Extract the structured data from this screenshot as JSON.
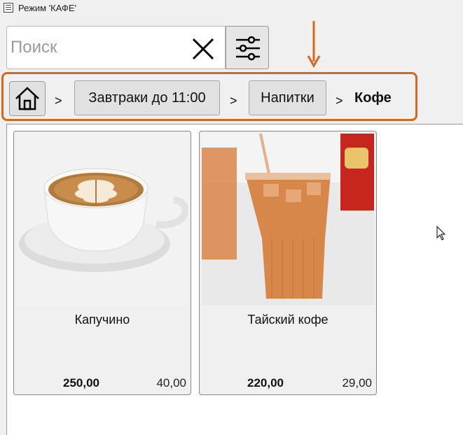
{
  "window": {
    "title": "Режим 'КАФЕ'"
  },
  "search": {
    "placeholder": "Поиск",
    "value": ""
  },
  "breadcrumb": {
    "items": [
      {
        "label": "Завтраки до 11:00"
      },
      {
        "label": "Напитки"
      }
    ],
    "separator": ">",
    "current": "Кофе"
  },
  "products": [
    {
      "name": "Капучино",
      "price": "250,00",
      "secondary_value": "40,00"
    },
    {
      "name": "Тайский кофе",
      "price": "220,00",
      "secondary_value": "29,00"
    }
  ],
  "colors": {
    "highlight": "#d2691e",
    "background": "#f0f0f0"
  }
}
